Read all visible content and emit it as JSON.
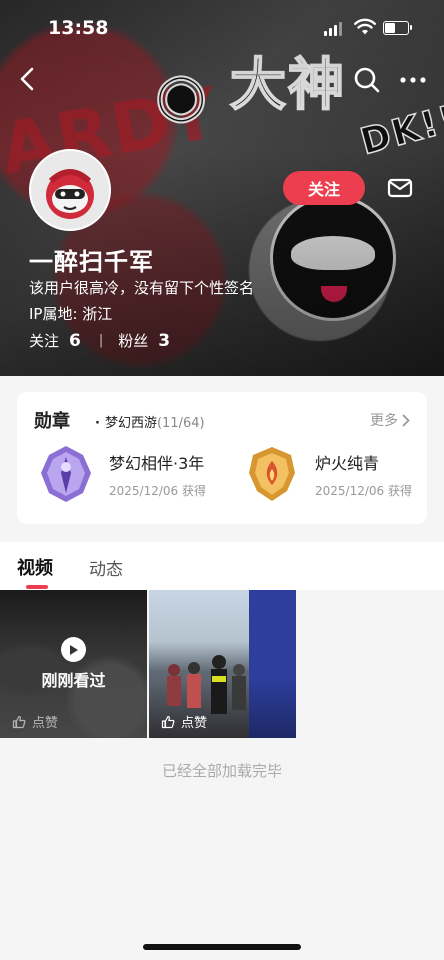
{
  "status_bar": {
    "time": "13:58"
  },
  "profile": {
    "username": "一醉扫千军",
    "bio": "该用户很高冷，没有留下个性签名",
    "ip_location": "IP属地: 浙江",
    "following_label": "关注",
    "following_count": "6",
    "followers_label": "粉丝",
    "followers_count": "3",
    "follow_button": "关注"
  },
  "medals": {
    "title": "勋章",
    "dot": "·",
    "game": "梦幻西游",
    "count": "(11/64)",
    "more": "更多",
    "items": [
      {
        "name": "梦幻相伴·3年",
        "date": "2025/12/06 获得"
      },
      {
        "name": "炉火纯青",
        "date": "2025/12/06 获得"
      }
    ]
  },
  "tabs": [
    {
      "label": "视频"
    },
    {
      "label": "动态"
    }
  ],
  "videos": [
    {
      "overlay": "刚刚看过",
      "like_label": "点赞"
    },
    {
      "like_label": "点赞"
    }
  ],
  "footer": {
    "end_text": "已经全部加载完毕"
  },
  "colors": {
    "accent": "#ec3e4e"
  }
}
